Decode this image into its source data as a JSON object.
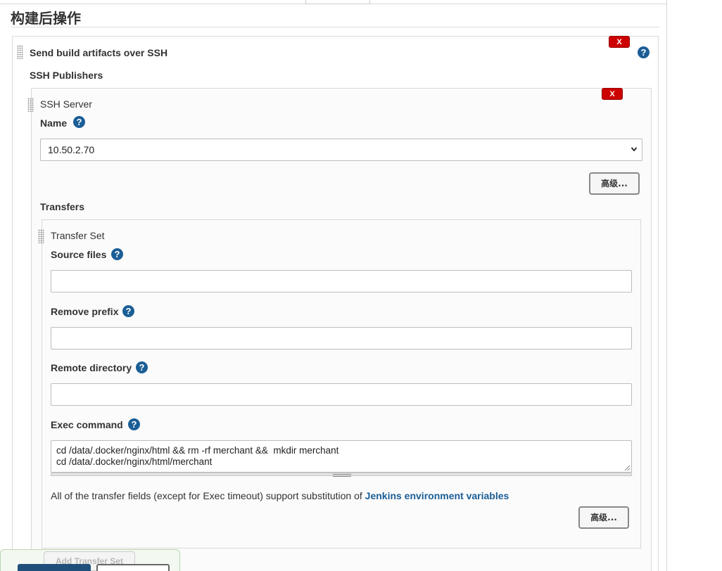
{
  "section": {
    "title": "构建后操作"
  },
  "publisher": {
    "title": "Send build artifacts over SSH",
    "delete_label": "X",
    "help_icon": "?",
    "publishers_label": "SSH Publishers"
  },
  "server": {
    "title": "SSH Server",
    "delete_label": "X",
    "name_label": "Name",
    "name_help": "?",
    "selected_server": "10.50.2.70",
    "advanced_label": "高级..."
  },
  "transfers": {
    "label": "Transfers",
    "set_title": "Transfer Set",
    "source_files_label": "Source files",
    "source_files_value": "",
    "remove_prefix_label": "Remove prefix",
    "remove_prefix_value": "",
    "remote_directory_label": "Remote directory",
    "remote_directory_value": "",
    "exec_command_label": "Exec command",
    "exec_command_value": "cd /data/.docker/nginx/html && rm -rf merchant &&  mkdir merchant\ncd /data/.docker/nginx/html/merchant",
    "help": "?",
    "info_prefix": "All of the transfer fields (except for Exec timeout) support substitution of ",
    "info_link": "Jenkins environment variables",
    "advanced_label": "高级...",
    "add_set_label": "Add Transfer Set"
  },
  "colors": {
    "accent": "#1b5e96",
    "delete": "#cc0000",
    "save_button": "#1f4f7a"
  }
}
